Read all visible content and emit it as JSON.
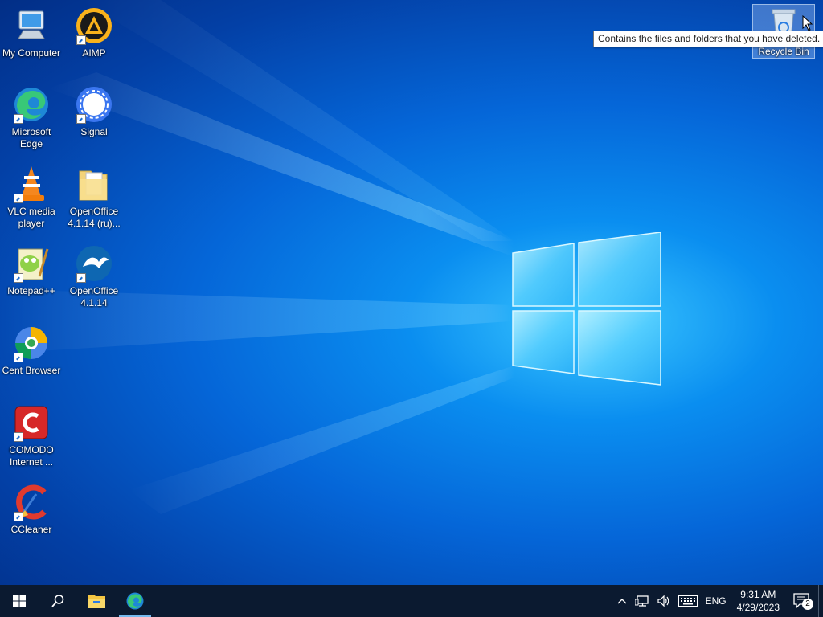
{
  "desktop": {
    "icons": [
      {
        "label": "My Computer",
        "icon": "computer-icon"
      },
      {
        "label": "AIMP",
        "icon": "aimp-icon"
      },
      {
        "label": "Microsoft Edge",
        "icon": "edge-icon"
      },
      {
        "label": "Signal",
        "icon": "signal-icon"
      },
      {
        "label": "VLC media player",
        "icon": "vlc-icon"
      },
      {
        "label": "OpenOffice 4.1.14 (ru)...",
        "icon": "folder-icon"
      },
      {
        "label": "Notepad++",
        "icon": "notepadpp-icon"
      },
      {
        "label": "OpenOffice 4.1.14",
        "icon": "openoffice-icon"
      },
      {
        "label": "Cent Browser",
        "icon": "cent-browser-icon"
      },
      {
        "label": "COMODO Internet ...",
        "icon": "comodo-icon"
      },
      {
        "label": "CCleaner",
        "icon": "ccleaner-icon"
      },
      {
        "label": "Recycle Bin",
        "icon": "recycle-bin-icon"
      }
    ],
    "tooltip": "Contains the files and folders that you have deleted.",
    "colors": {
      "wallpaper_center": "#3cc8ff",
      "wallpaper_edge": "#022e86",
      "taskbar": "#0b1a30",
      "accent": "#76b9ed"
    }
  },
  "taskbar": {
    "buttons": [
      {
        "name": "start",
        "icon": "windows-start-icon"
      },
      {
        "name": "search",
        "icon": "search-icon"
      },
      {
        "name": "file-explorer",
        "icon": "folder-icon"
      },
      {
        "name": "edge",
        "icon": "edge-icon",
        "active": true
      }
    ],
    "tray": {
      "language": "ENG",
      "time": "9:31 AM",
      "date": "4/29/2023",
      "notification_count": "2",
      "icons": [
        "chevron-up-icon",
        "network-icon",
        "volume-icon",
        "keyboard-icon"
      ]
    }
  }
}
